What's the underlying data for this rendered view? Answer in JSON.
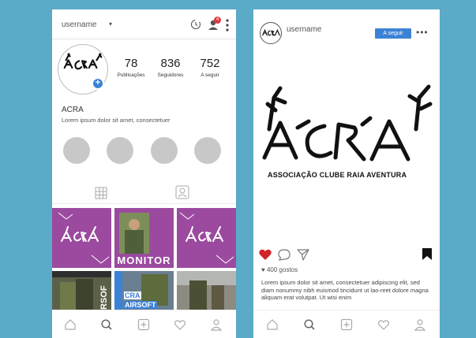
{
  "left_phone": {
    "topbar": {
      "username": "username",
      "caret": "▾",
      "badge_count": "4"
    },
    "stats": [
      {
        "value": "78",
        "label": "Publicações"
      },
      {
        "value": "836",
        "label": "Seguidores"
      },
      {
        "value": "752",
        "label": "A seguir"
      }
    ],
    "profile": {
      "name": "ACRA",
      "bio": "Lorem ipsum dolor sit amet, consectetuer"
    },
    "tiles": {
      "monitor": "MONITOR",
      "cra_airsoft_1": "CRA",
      "cra_airsoft_2": "AIRSOFT",
      "rsof": "IRSOF"
    }
  },
  "right_phone": {
    "header": {
      "username": "username",
      "follow_label": "A seguir",
      "more": "•••"
    },
    "logo_subtitle": "ASSOCIAÇÃO  CLUBE RAIA  AVENTURA",
    "likes": "400 gostos",
    "caption": "Lorem ipsum dolor sit amet, consectetuer adipiscing elit, sed diam nonummy nibh euismod tincidunt ut lao-reet dolore magna aliquam erat volutpat. Ut wisi enim"
  },
  "colors": {
    "background": "#5aaac8",
    "accent_blue": "#3b82d6",
    "tile_purple": "#9b4a9f",
    "heart_red": "#d0232a"
  }
}
